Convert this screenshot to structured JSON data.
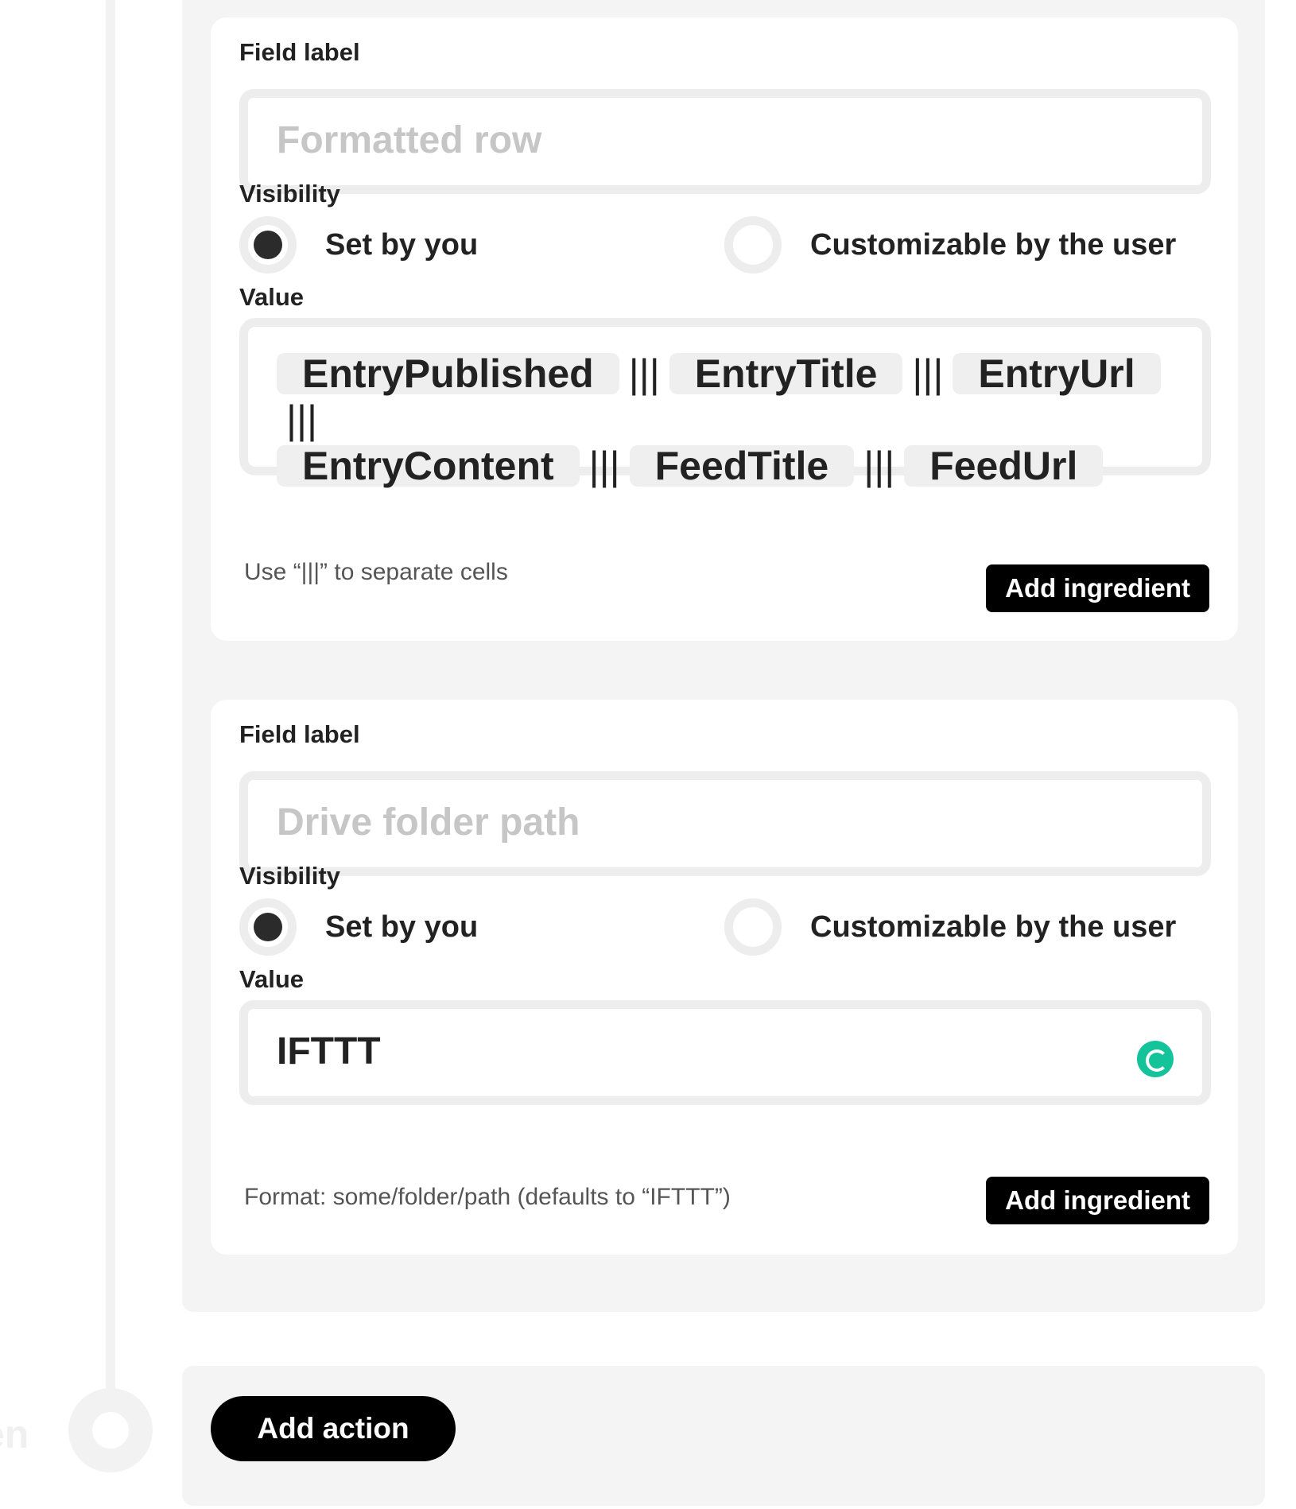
{
  "timeline": {
    "node_label": "en"
  },
  "card1": {
    "field_label_heading": "Field label",
    "field_label_placeholder": "Formatted row",
    "visibility_heading": "Visibility",
    "visibility_options": [
      "Set by you",
      "Customizable by the user"
    ],
    "visibility_selected": "Set by you",
    "value_heading": "Value",
    "value_ingredients": [
      "EntryPublished",
      "EntryTitle",
      "EntryUrl",
      "EntryContent",
      "FeedTitle",
      "FeedUrl"
    ],
    "separator": "|||",
    "help_text": "Use “|||” to separate cells",
    "add_ingredient_label": "Add ingredient"
  },
  "card2": {
    "field_label_heading": "Field label",
    "field_label_placeholder": "Drive folder path",
    "visibility_heading": "Visibility",
    "visibility_options": [
      "Set by you",
      "Customizable by the user"
    ],
    "visibility_selected": "Set by you",
    "value_heading": "Value",
    "value_text": "IFTTT",
    "help_text": "Format: some/folder/path (defaults to “IFTTT”)",
    "add_ingredient_label": "Add ingredient",
    "grammarly_icon": "grammarly-icon",
    "grammarly_color": "#15c39a"
  },
  "add_action": {
    "label": "Add action"
  },
  "colors": {
    "panel_background": "#f4f4f4",
    "card_background": "#ffffff",
    "button_background": "#000000",
    "button_text": "#ffffff",
    "border": "#ededed",
    "placeholder": "#c6c6c6"
  }
}
